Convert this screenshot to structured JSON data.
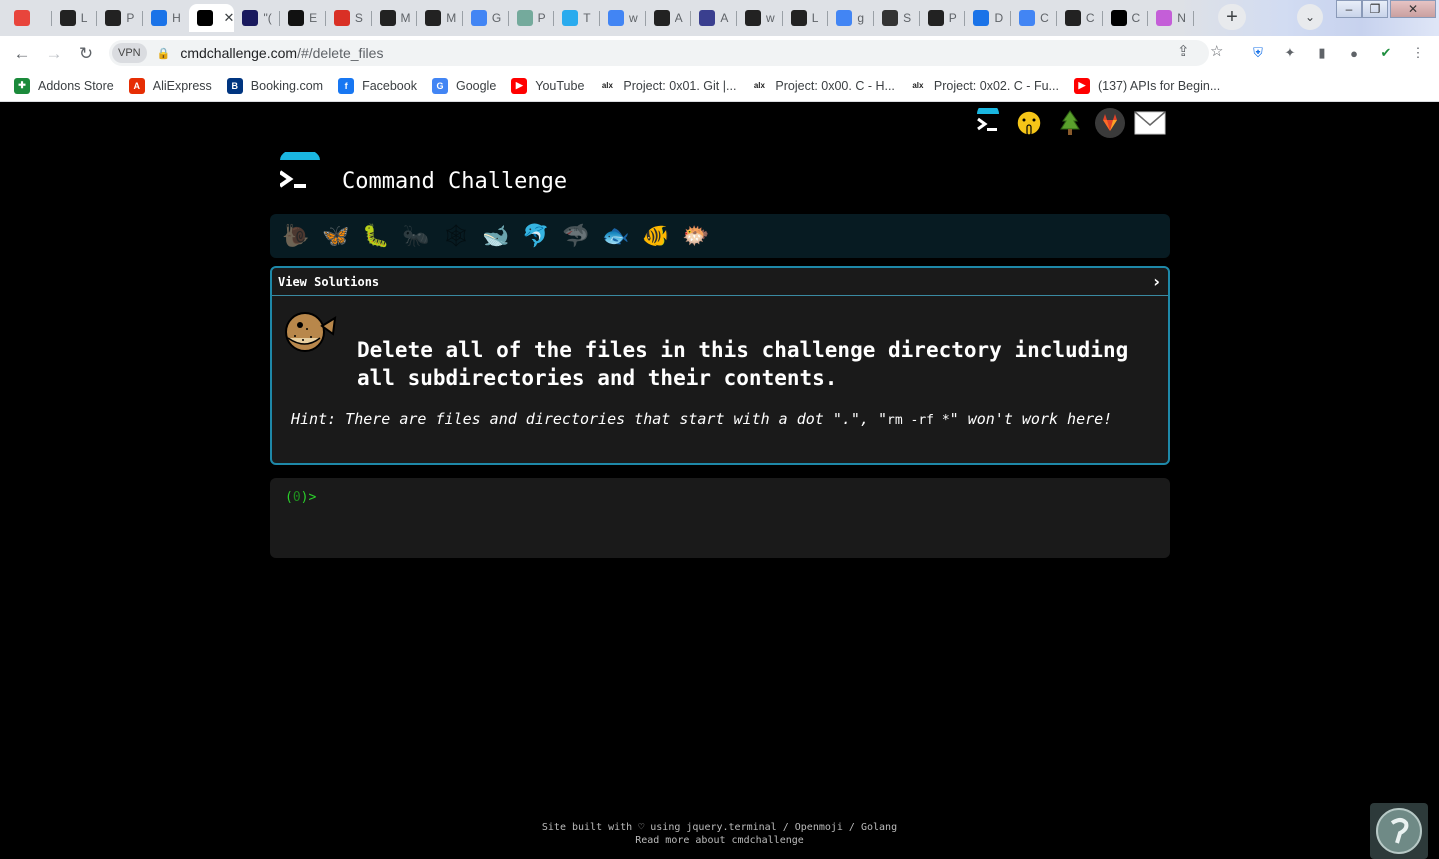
{
  "browser": {
    "tabs": [
      {
        "letter": "",
        "icon": "chrome-icon",
        "color": "#e8453c"
      },
      {
        "letter": "L",
        "icon": "alx-icon",
        "color": "#222"
      },
      {
        "letter": "P",
        "icon": "alx-icon",
        "color": "#222"
      },
      {
        "letter": "H",
        "icon": "sync-icon",
        "color": "#1a73e8"
      },
      {
        "letter": "",
        "icon": "terminal-icon",
        "color": "#000",
        "active": true
      },
      {
        "letter": "\"(",
        "icon": "dev-icon",
        "color": "#1a1a5e"
      },
      {
        "letter": "E",
        "icon": "github-icon",
        "color": "#111"
      },
      {
        "letter": "S",
        "icon": "gmail-icon",
        "color": "#d93025"
      },
      {
        "letter": "M",
        "icon": "alx-icon",
        "color": "#222"
      },
      {
        "letter": "M",
        "icon": "alx-icon",
        "color": "#222"
      },
      {
        "letter": "G",
        "icon": "docs-icon",
        "color": "#4285f4"
      },
      {
        "letter": "P",
        "icon": "chatgpt-icon",
        "color": "#74aa9c"
      },
      {
        "letter": "T",
        "icon": "telegram-icon",
        "color": "#2aabee"
      },
      {
        "letter": "w",
        "icon": "google-icon",
        "color": "#4285f4"
      },
      {
        "letter": "A",
        "icon": "alx-icon",
        "color": "#222"
      },
      {
        "letter": "A",
        "icon": "globe-icon",
        "color": "#3a3f8f"
      },
      {
        "letter": "w",
        "icon": "alx-icon",
        "color": "#222"
      },
      {
        "letter": "L",
        "icon": "alx-icon",
        "color": "#222"
      },
      {
        "letter": "g",
        "icon": "google-icon",
        "color": "#4285f4"
      },
      {
        "letter": "S",
        "icon": "gear-icon",
        "color": "#333"
      },
      {
        "letter": "P",
        "icon": "project-icon",
        "color": "#222"
      },
      {
        "letter": "D",
        "icon": "download-icon",
        "color": "#1a73e8"
      },
      {
        "letter": "C",
        "icon": "google-icon",
        "color": "#4285f4"
      },
      {
        "letter": "C",
        "icon": "ai-icon",
        "color": "#222"
      },
      {
        "letter": "C",
        "icon": "terminal-icon",
        "color": "#000"
      },
      {
        "letter": "N",
        "icon": "circle-icon",
        "color": "#c45ed8"
      }
    ],
    "address": {
      "vpn": "VPN",
      "host": "cmdchallenge.com",
      "path": "/#/delete_files"
    },
    "bookmarks": [
      {
        "label": "Addons Store",
        "icon": "addons-icon",
        "color": "#1b8a3b",
        "glyph": "✚"
      },
      {
        "label": "AliExpress",
        "icon": "aliexpress-icon",
        "color": "#e62e04",
        "glyph": "A"
      },
      {
        "label": "Booking.com",
        "icon": "booking-icon",
        "color": "#003580",
        "glyph": "B"
      },
      {
        "label": "Facebook",
        "icon": "facebook-icon",
        "color": "#1877f2",
        "glyph": "f"
      },
      {
        "label": "Google",
        "icon": "google-icon",
        "color": "#4285f4",
        "glyph": "G"
      },
      {
        "label": "YouTube",
        "icon": "youtube-icon",
        "color": "#ff0000",
        "glyph": "▶"
      },
      {
        "label": "Project: 0x01. Git |...",
        "icon": "alx-icon",
        "color": "#222",
        "glyph": "alx"
      },
      {
        "label": "Project: 0x00. C - H...",
        "icon": "alx-icon",
        "color": "#222",
        "glyph": "alx"
      },
      {
        "label": "Project: 0x02. C - Fu...",
        "icon": "alx-icon",
        "color": "#222",
        "glyph": "alx"
      },
      {
        "label": "(137) APIs for Begin...",
        "icon": "youtube-icon",
        "color": "#ff0000",
        "glyph": "▶"
      }
    ]
  },
  "site": {
    "title": "Command Challenge",
    "social": [
      "terminal-icon",
      "shushing-face-icon",
      "tree-icon",
      "gitlab-icon",
      "envelope-icon"
    ],
    "levels": [
      {
        "name": "snail",
        "glyph": "🐌",
        "dim": true
      },
      {
        "name": "butterfly",
        "glyph": "🦋"
      },
      {
        "name": "caterpillar",
        "glyph": "🐛"
      },
      {
        "name": "ant",
        "glyph": "🐜",
        "dim": true
      },
      {
        "name": "spider-web",
        "glyph": "🕸",
        "dim": true
      },
      {
        "name": "whale",
        "glyph": "🐋"
      },
      {
        "name": "dolphin",
        "glyph": "🐬"
      },
      {
        "name": "shark",
        "glyph": "🦈",
        "dim": true
      },
      {
        "name": "fish",
        "glyph": "🐟"
      },
      {
        "name": "tropical-fish",
        "glyph": "🐠"
      },
      {
        "name": "blowfish",
        "glyph": "🐡"
      }
    ],
    "challenge": {
      "solutions_label": "View Solutions",
      "arrow": "›",
      "task": "Delete all of the files in this challenge directory including all subdirectories and their contents.",
      "hint_prefix": "Hint: There are files and directories that start with a dot \".\", \"",
      "hint_code": "rm -rf *",
      "hint_suffix": "\" won't work here!"
    },
    "terminal": {
      "prompt_open": "(",
      "prompt_num": "0",
      "prompt_close": ")>"
    },
    "footer": {
      "line1": "Site built with ♡ using jquery.terminal / Openmoji / Golang",
      "line2": "Read more about cmdchallenge"
    },
    "colors": {
      "accent": "#1e88a8",
      "prompt": "#2bd12b",
      "panel": "#1a1a1a",
      "level_bar": "#071b22"
    }
  }
}
